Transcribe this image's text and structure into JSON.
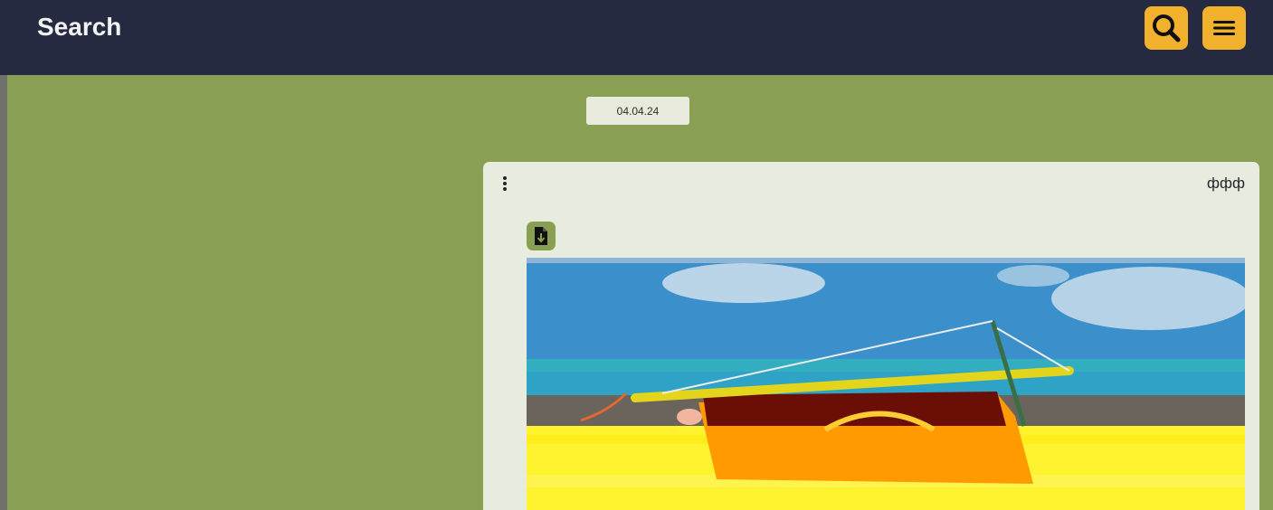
{
  "header": {
    "title": "Search",
    "search_icon": "search-icon",
    "menu_icon": "hamburger-menu-icon",
    "accent_color": "#f2b12d",
    "background_color": "#262a40"
  },
  "chat": {
    "background_color": "#89a054",
    "date_label": "04.04.24",
    "message": {
      "sender": "ффф",
      "options_icon": "kebab-menu-icon",
      "download_icon": "file-download-icon",
      "image_icon": "image-photo"
    }
  }
}
